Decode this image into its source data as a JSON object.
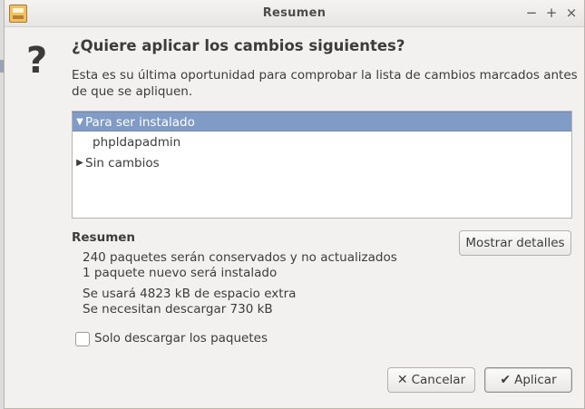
{
  "window": {
    "title": "Resumen",
    "controls": {
      "minimize": "−",
      "maximize": "+",
      "close": "×"
    }
  },
  "dialog": {
    "icon": "question-mark-icon",
    "icon_glyph": "?",
    "heading": "¿Quiere aplicar los cambios siguientes?",
    "description": "Esta es su última oportunidad para comprobar la lista de cambios marcados antes de que se apliquen."
  },
  "changes_tree": {
    "rows": [
      {
        "label": "Para ser instalado",
        "expanded": true,
        "selected": true,
        "expander": "▼"
      },
      {
        "label": "phpldapadmin",
        "level": 1
      },
      {
        "label": "Sin cambios",
        "expanded": false,
        "selected": false,
        "expander": "▶"
      }
    ]
  },
  "summary": {
    "title": "Resumen",
    "lines": [
      "240 paquetes serán conservados y no actualizados",
      "1 paquete nuevo será instalado",
      "Se usará 4823 kB de espacio extra",
      "Se necesitan descargar 730 kB"
    ],
    "details_button": "Mostrar detalles"
  },
  "options": {
    "download_only_label": "Solo descargar los paquetes",
    "download_only_checked": false
  },
  "actions": {
    "cancel_label": "Cancelar",
    "cancel_icon": "✕",
    "apply_label": "Aplicar",
    "apply_icon": "✔"
  }
}
